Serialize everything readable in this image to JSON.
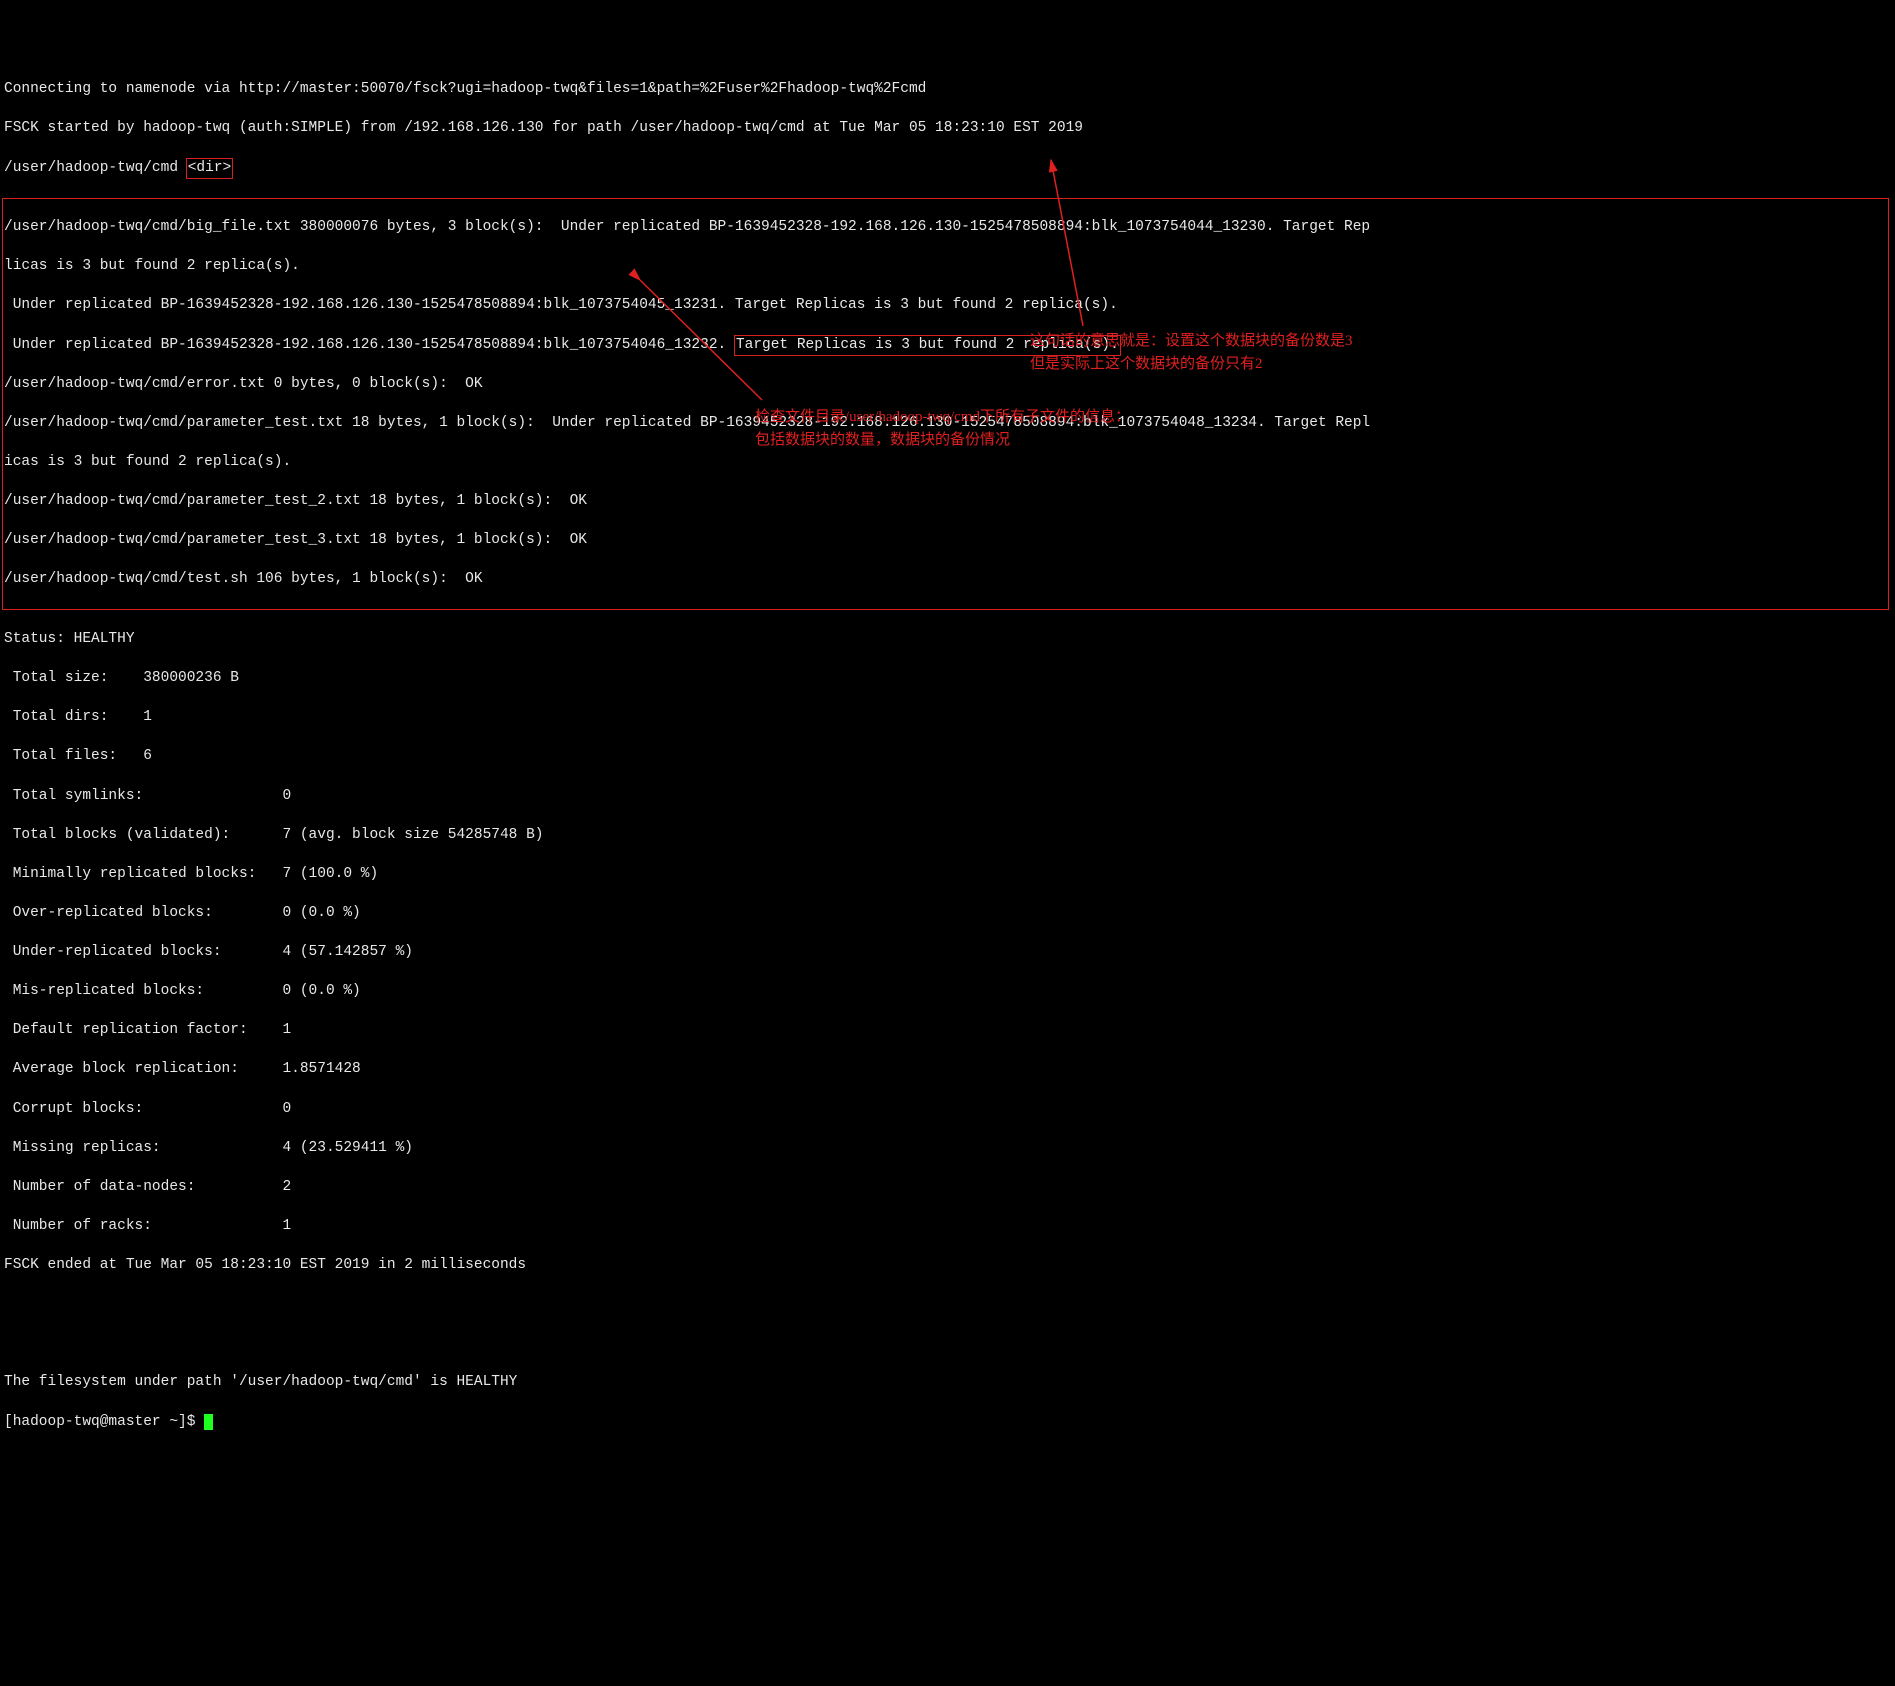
{
  "header": {
    "line1": "Connecting to namenode via http://master:50070/fsck?ugi=hadoop-twq&files=1&path=%2Fuser%2Fhadoop-twq%2Fcmd",
    "line2": "FSCK started by hadoop-twq (auth:SIMPLE) from /192.168.126.130 for path /user/hadoop-twq/cmd at Tue Mar 05 18:23:10 EST 2019",
    "line3a": "/user/hadoop-twq/cmd ",
    "line3b": "<dir>"
  },
  "block": {
    "l1": "/user/hadoop-twq/cmd/big_file.txt 380000076 bytes, 3 block(s):  Under replicated BP-1639452328-192.168.126.130-1525478508894:blk_1073754044_13230. Target Rep",
    "l2": "licas is 3 but found 2 replica(s).",
    "l3": " Under replicated BP-1639452328-192.168.126.130-1525478508894:blk_1073754045_13231. Target Replicas is 3 but found 2 replica(s).",
    "l4a": " Under replicated BP-1639452328-192.168.126.130-1525478508894:blk_1073754046_13232. ",
    "l4b": "Target Replicas is 3 but found 2 replica(s).",
    "l5": "/user/hadoop-twq/cmd/error.txt 0 bytes, 0 block(s):  OK",
    "l6": "/user/hadoop-twq/cmd/parameter_test.txt 18 bytes, 1 block(s):  Under replicated BP-1639452328-192.168.126.130-1525478508894:blk_1073754048_13234. Target Repl",
    "l7": "icas is 3 but found 2 replica(s).",
    "l8": "/user/hadoop-twq/cmd/parameter_test_2.txt 18 bytes, 1 block(s):  OK",
    "l9": "/user/hadoop-twq/cmd/parameter_test_3.txt 18 bytes, 1 block(s):  OK",
    "l10": "/user/hadoop-twq/cmd/test.sh 106 bytes, 1 block(s):  OK"
  },
  "status": {
    "title": "Status: HEALTHY",
    "r1": " Total size:    380000236 B",
    "r2": " Total dirs:    1",
    "r3": " Total files:   6",
    "r4": " Total symlinks:                0",
    "r5": " Total blocks (validated):      7 (avg. block size 54285748 B)",
    "r6": " Minimally replicated blocks:   7 (100.0 %)",
    "r7": " Over-replicated blocks:        0 (0.0 %)",
    "r8": " Under-replicated blocks:       4 (57.142857 %)",
    "r9": " Mis-replicated blocks:         0 (0.0 %)",
    "r10": " Default replication factor:    1",
    "r11": " Average block replication:     1.8571428",
    "r12": " Corrupt blocks:                0",
    "r13": " Missing replicas:              4 (23.529411 %)",
    "r14": " Number of data-nodes:          2",
    "r15": " Number of racks:               1",
    "end": "FSCK ended at Tue Mar 05 18:23:10 EST 2019 in 2 milliseconds"
  },
  "footer": {
    "healthy": "The filesystem under path '/user/hadoop-twq/cmd' is HEALTHY",
    "prompt": "[hadoop-twq@master ~]$ "
  },
  "annotations": {
    "right1": "这句话的意思就是：设置这个数据块的备份数是3",
    "right2": "但是实际上这个数据块的备份只有2",
    "left1": "检查文件目录/user/hadoop-twq/cmd下所有子文件的信息：",
    "left2": "包括数据块的数量，数据块的备份情况"
  }
}
